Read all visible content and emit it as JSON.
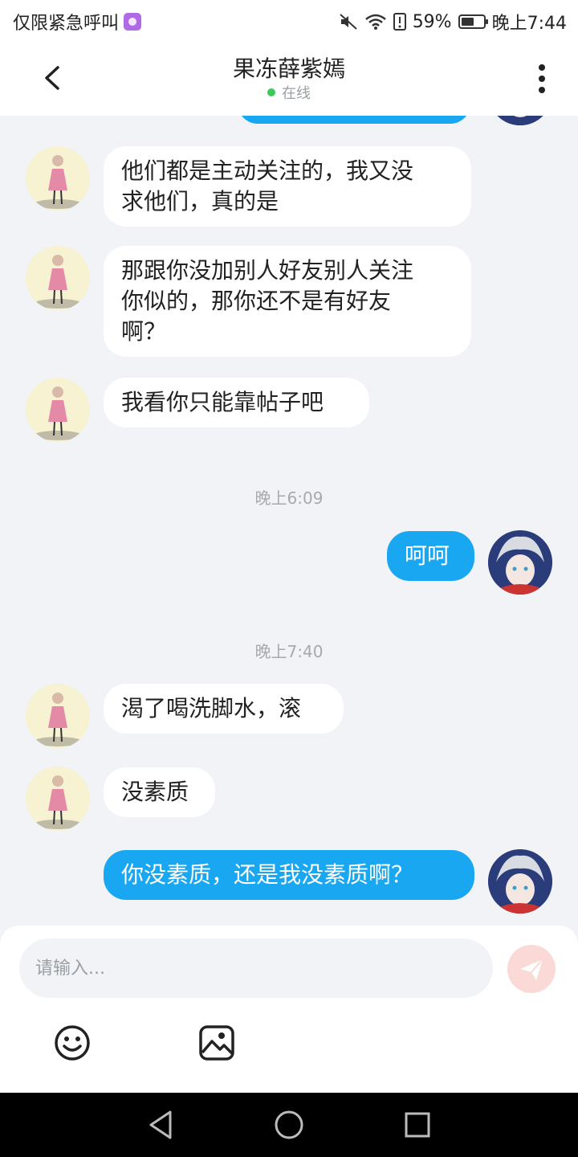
{
  "status_bar": {
    "left_text": "仅限紧急呼叫",
    "battery": "59%",
    "battery_level": 0.59,
    "time": "晚上7:44"
  },
  "header": {
    "title": "果冻薛紫嫣",
    "status": "在线"
  },
  "messages": [
    {
      "side": "in",
      "text_lines": [
        "他们都是主动关注的，我又没",
        "求他们，真的是"
      ]
    },
    {
      "side": "in",
      "text_lines": [
        "那跟你没加别人好友别人关注",
        "你似的，那你还不是有好友",
        "啊？"
      ]
    },
    {
      "side": "in",
      "text": "我看你只能靠帖子吧"
    },
    {
      "timestamp": "晚上6:09"
    },
    {
      "side": "out",
      "text": "呵呵"
    },
    {
      "timestamp": "晚上7:40"
    },
    {
      "side": "in",
      "text": "渴了喝洗脚水，滚"
    },
    {
      "side": "in",
      "text": "没素质"
    },
    {
      "side": "out",
      "text": "你没素质，还是我没素质啊？"
    }
  ],
  "composer": {
    "placeholder": "请输入..."
  },
  "icons": {
    "back": "chevron-left-icon",
    "more": "more-vertical-icon",
    "send": "send-icon",
    "emoji": "smiley-icon",
    "image": "image-icon",
    "nav_back": "triangle-back-icon",
    "nav_home": "circle-home-icon",
    "nav_recent": "square-recent-icon"
  },
  "colors": {
    "outgoing_bubble": "#1aa7f2",
    "incoming_bubble": "#ffffff",
    "chat_background": "#f1f3f6",
    "online_dot": "#3cc85a",
    "send_button": "#fbd9d7"
  }
}
